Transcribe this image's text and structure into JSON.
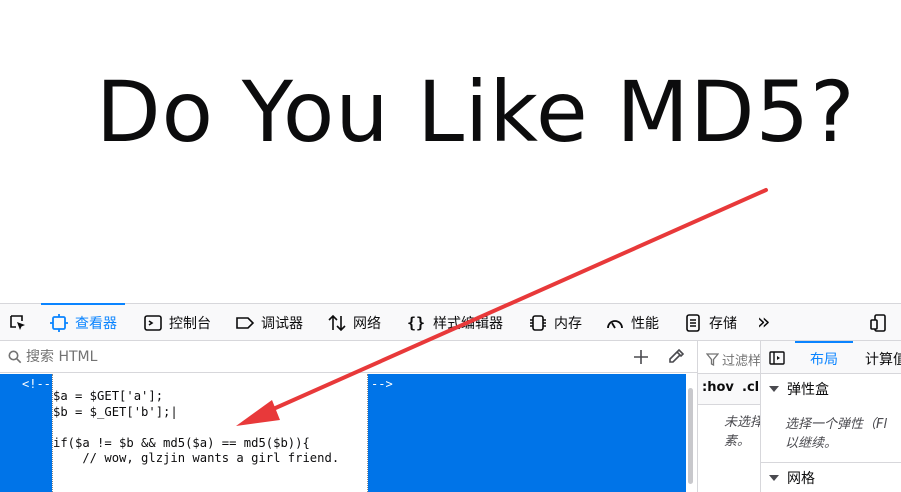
{
  "page": {
    "heading": "Do You Like MD5?"
  },
  "toolbar": {
    "items": [
      {
        "label": "查看器",
        "icon": "inspector-icon"
      },
      {
        "label": "控制台",
        "icon": "console-icon"
      },
      {
        "label": "调试器",
        "icon": "debugger-icon"
      },
      {
        "label": "网络",
        "icon": "network-icon"
      },
      {
        "label": "样式编辑器",
        "icon": "style-editor-icon"
      },
      {
        "label": "内存",
        "icon": "memory-icon"
      },
      {
        "label": "性能",
        "icon": "performance-icon"
      },
      {
        "label": "存储",
        "icon": "storage-icon"
      }
    ],
    "more": "»"
  },
  "search": {
    "placeholder": "搜索 HTML"
  },
  "markup": {
    "comment_open": "<!--",
    "comment_close": "-->",
    "code": "$a = $GET['a'];\n$b = $_GET['b'];|\n\nif($a != $b && md5($a) == md5($b)){\n    // wow, glzjin wants a girl friend."
  },
  "rules": {
    "filter_label": "过滤样",
    "hov": ":hov",
    "cls": ".cl",
    "message_line1": "未选择",
    "message_line2": "素。"
  },
  "layout": {
    "tab_layout": "布局",
    "tab_computed": "计算值",
    "flexbox_title": "弹性盒",
    "flexbox_hint_line1": "选择一个弹性（Fl",
    "flexbox_hint_line2": "以继续。",
    "grid_title": "网格"
  },
  "colors": {
    "accent": "#0a84ff",
    "selection": "#0074e8",
    "arrow": "#e8393a"
  }
}
